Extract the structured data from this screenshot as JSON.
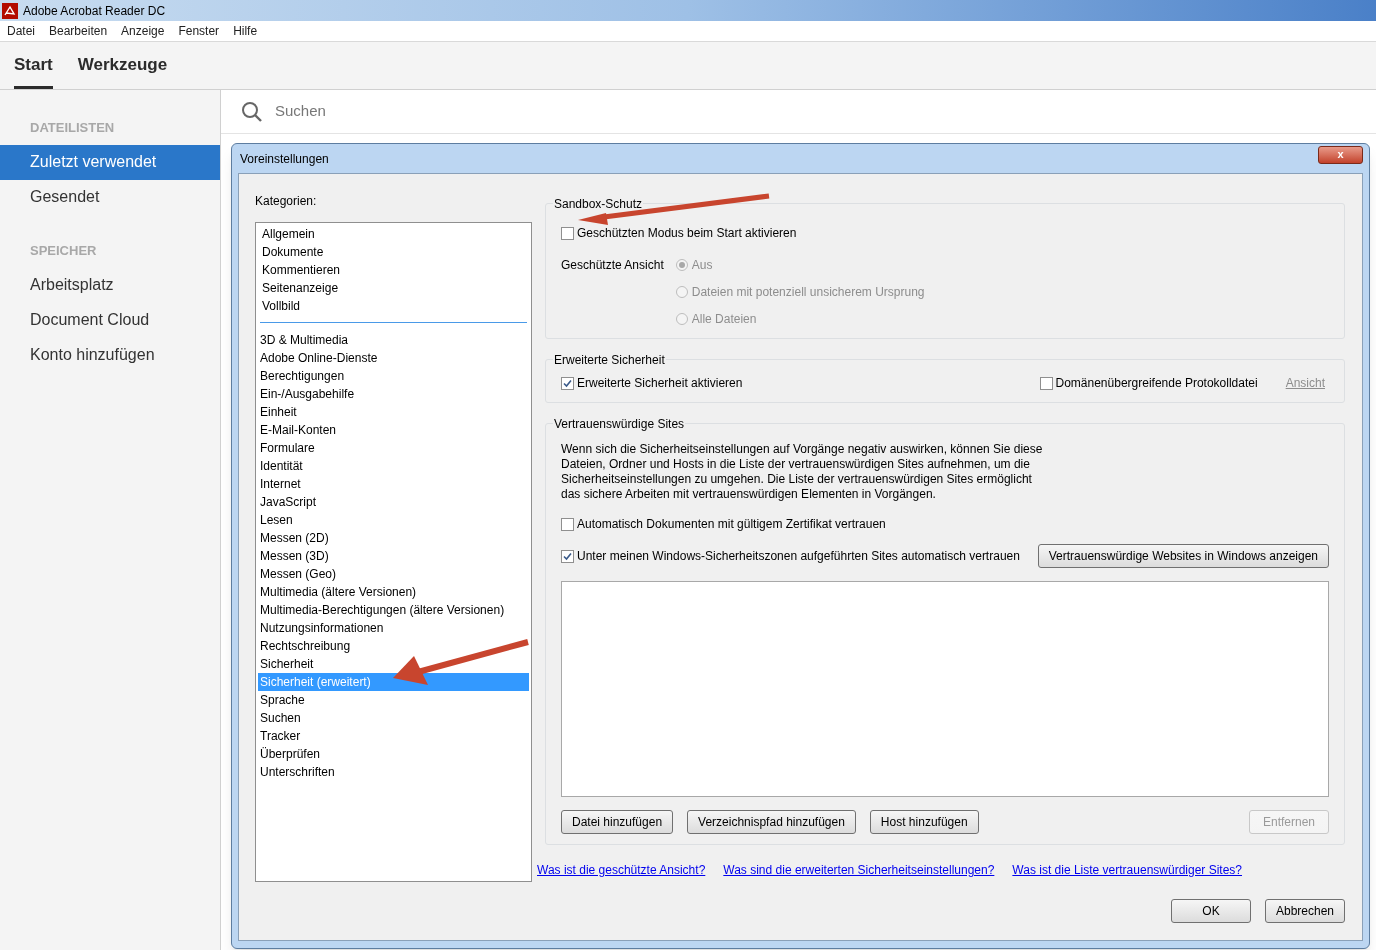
{
  "window": {
    "title": "Adobe Acrobat Reader DC"
  },
  "menu": [
    "Datei",
    "Bearbeiten",
    "Anzeige",
    "Fenster",
    "Hilfe"
  ],
  "tabs": [
    {
      "label": "Start",
      "selected": true
    },
    {
      "label": "Werkzeuge",
      "selected": false
    }
  ],
  "search": {
    "placeholder": "Suchen"
  },
  "sidebar": {
    "sections": [
      {
        "heading": "DATEILISTEN",
        "items": [
          {
            "label": "Zuletzt verwendet",
            "selected": true
          },
          {
            "label": "Gesendet",
            "selected": false
          }
        ]
      },
      {
        "heading": "SPEICHER",
        "items": [
          {
            "label": "Arbeitsplatz",
            "selected": false
          },
          {
            "label": "Document Cloud",
            "selected": false
          },
          {
            "label": "Konto hinzufügen",
            "selected": false
          }
        ]
      }
    ]
  },
  "dialog": {
    "title": "Voreinstellungen",
    "close": "x",
    "categories_label": "Kategorien:",
    "category_groups": [
      [
        {
          "label": "Allgemein",
          "selected": false
        },
        {
          "label": "Dokumente",
          "selected": false
        },
        {
          "label": "Kommentieren",
          "selected": false
        },
        {
          "label": "Seitenanzeige",
          "selected": false
        },
        {
          "label": "Vollbild",
          "selected": false
        }
      ],
      [
        {
          "label": "3D & Multimedia",
          "selected": false
        },
        {
          "label": "Adobe Online-Dienste",
          "selected": false
        },
        {
          "label": "Berechtigungen",
          "selected": false
        },
        {
          "label": "Ein-/Ausgabehilfe",
          "selected": false
        },
        {
          "label": "Einheit",
          "selected": false
        },
        {
          "label": "E-Mail-Konten",
          "selected": false
        },
        {
          "label": "Formulare",
          "selected": false
        },
        {
          "label": "Identität",
          "selected": false
        },
        {
          "label": "Internet",
          "selected": false
        },
        {
          "label": "JavaScript",
          "selected": false
        },
        {
          "label": "Lesen",
          "selected": false
        },
        {
          "label": "Messen (2D)",
          "selected": false
        },
        {
          "label": "Messen (3D)",
          "selected": false
        },
        {
          "label": "Messen (Geo)",
          "selected": false
        },
        {
          "label": "Multimedia (ältere Versionen)",
          "selected": false
        },
        {
          "label": "Multimedia-Berechtigungen (ältere Versionen)",
          "selected": false
        },
        {
          "label": "Nutzungsinformationen",
          "selected": false
        },
        {
          "label": "Rechtschreibung",
          "selected": false
        },
        {
          "label": "Sicherheit",
          "selected": false
        },
        {
          "label": "Sicherheit (erweitert)",
          "selected": true
        },
        {
          "label": "Sprache",
          "selected": false
        },
        {
          "label": "Suchen",
          "selected": false
        },
        {
          "label": "Tracker",
          "selected": false
        },
        {
          "label": "Überprüfen",
          "selected": false
        },
        {
          "label": "Unterschriften",
          "selected": false
        }
      ]
    ],
    "sandbox": {
      "title": "Sandbox-Schutz",
      "protected_mode": {
        "label": "Geschützten Modus beim Start aktivieren",
        "checked": false
      },
      "protected_view": {
        "label": "Geschützte Ansicht",
        "disabled": true,
        "options": [
          {
            "label": "Aus",
            "selected": true
          },
          {
            "label": "Dateien mit potenziell unsicherem Ursprung",
            "selected": false
          },
          {
            "label": "Alle Dateien",
            "selected": false
          }
        ]
      }
    },
    "enhanced": {
      "title": "Erweiterte Sicherheit",
      "enable": {
        "label": "Erweiterte Sicherheit aktivieren",
        "checked": true
      },
      "log": {
        "label": "Domänenübergreifende Protokolldatei",
        "checked": false
      },
      "view_link": {
        "label": "Ansicht",
        "disabled": true
      }
    },
    "trusted": {
      "title": "Vertrauenswürdige Sites",
      "description": "Wenn sich die Sicherheitseinstellungen auf Vorgänge negativ auswirken,  können Sie diese Dateien, Ordner und Hosts in die Liste der vertrauenswürdigen Sites aufnehmen, um die Sicherheitseinstellungen zu umgehen. Die Liste der vertrauenswürdigen Sites ermöglicht das sichere Arbeiten mit vertrauenswürdigen Elementen in Vorgängen.",
      "cert": {
        "label": "Automatisch Dokumenten mit gültigem Zertifikat vertrauen",
        "checked": false
      },
      "zones": {
        "label": "Unter meinen Windows-Sicherheitszonen aufgeführten Sites automatisch vertrauen",
        "checked": true
      },
      "zones_button": "Vertrauenswürdige Websites in Windows anzeigen",
      "buttons": [
        {
          "label": "Datei hinzufügen",
          "disabled": false
        },
        {
          "label": "Verzeichnispfad hinzufügen",
          "disabled": false
        },
        {
          "label": "Host hinzufügen",
          "disabled": false
        },
        {
          "label": "Entfernen",
          "disabled": true
        }
      ]
    },
    "links": [
      "Was ist die geschützte Ansicht?",
      "Was sind die erweiterten Sicherheitseinstellungen?",
      "Was ist die Liste vertrauenswürdiger Sites?"
    ],
    "ok": "OK",
    "cancel": "Abbrechen"
  }
}
